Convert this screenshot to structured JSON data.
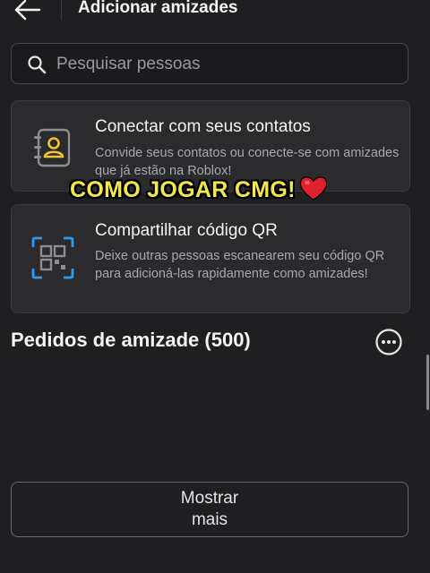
{
  "header": {
    "title": "Adicionar amizades",
    "back_icon": "arrow-left-icon"
  },
  "search": {
    "placeholder": "Pesquisar pessoas",
    "icon": "search-icon"
  },
  "cards": [
    {
      "title": "Conectar com seus contatos",
      "description": "Convide seus contatos ou conecte-se com amizades que já estão na Roblox!",
      "icon": "contacts-book-icon",
      "icon_color": "#f2c230"
    },
    {
      "title": "Compartilhar código QR",
      "description": "Deixe outras pessoas escanearem seu código QR para adicioná-las rapidamente como amizades!",
      "icon": "qr-code-icon",
      "icon_color": "#2b9cf2"
    }
  ],
  "overlay": {
    "text": "COMO JOGAR CMG!",
    "color": "#f2e84a",
    "emoji": "heart-icon"
  },
  "requests": {
    "title": "Pedidos de amizade (500)",
    "more_icon": "ellipsis-circle-icon"
  },
  "show_more": {
    "line1": "Mostrar",
    "line2": "mais"
  }
}
